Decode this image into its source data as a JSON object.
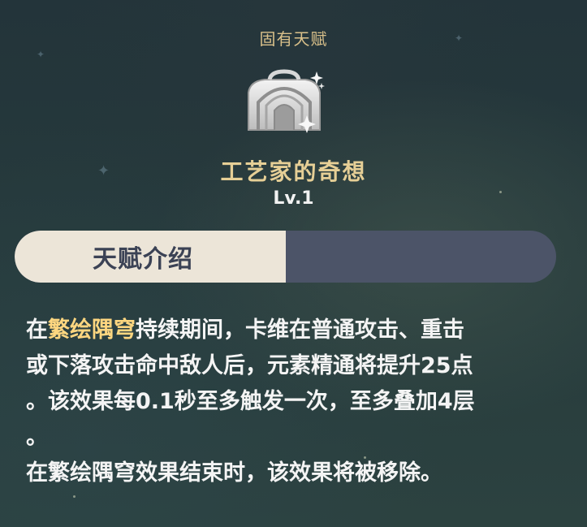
{
  "header": {
    "title": "固有天赋"
  },
  "talent": {
    "icon": "crafted-cottage-icon",
    "name": "工艺家的奇想",
    "level": "Lv.1"
  },
  "tabs": [
    {
      "label": "天赋介绍",
      "active": true
    },
    {
      "label": "",
      "active": false
    }
  ],
  "description": {
    "line1_pre": "在",
    "line1_hl": "繁绘隅穹",
    "line1_post": "持续期间，卡维在普通攻击、重击",
    "line2": "或下落攻击命中敌人后，元素精通将提升25点",
    "line3": "。该效果每0.1秒至多触发一次，至多叠加4层",
    "line4": "。",
    "line5": "在繁绘隅穹效果结束时，该效果将被移除。"
  },
  "colors": {
    "header_gold": "#d9c08a",
    "name_gold": "#e6cf96",
    "highlight": "#ffd780",
    "tab_active_bg": "#ece5d8",
    "tab_inactive_bg": "#4c5468",
    "tab_active_text": "#3b4255"
  }
}
